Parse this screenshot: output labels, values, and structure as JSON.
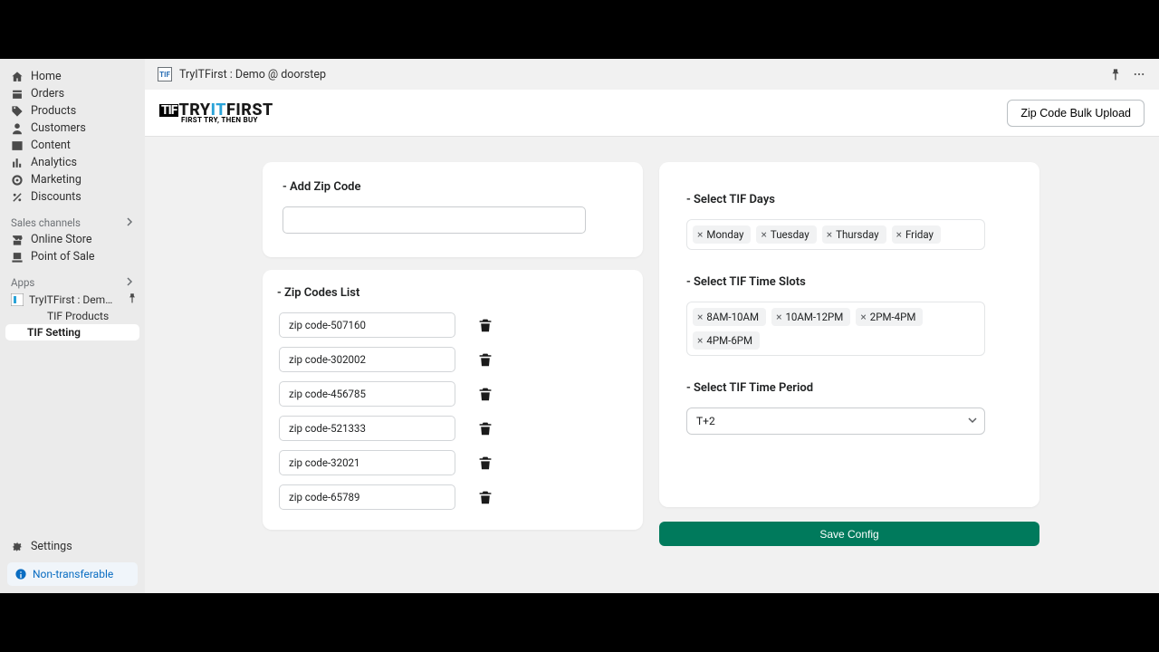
{
  "sidebar": {
    "nav": [
      {
        "label": "Home"
      },
      {
        "label": "Orders"
      },
      {
        "label": "Products"
      },
      {
        "label": "Customers"
      },
      {
        "label": "Content"
      },
      {
        "label": "Analytics"
      },
      {
        "label": "Marketing"
      },
      {
        "label": "Discounts"
      }
    ],
    "channels_label": "Sales channels",
    "channels": [
      {
        "label": "Online Store"
      },
      {
        "label": "Point of Sale"
      }
    ],
    "apps_label": "Apps",
    "app_entry": "TryITFirst : Demo @ d...",
    "app_sub": [
      {
        "label": "TIF Products"
      },
      {
        "label": "TIF Setting",
        "active": true
      }
    ],
    "settings": "Settings",
    "info": "Non-transferable"
  },
  "header": {
    "title": "TryITFirst : Demo @ doorstep"
  },
  "appbar": {
    "brand_primary_try": "TRY",
    "brand_primary_it": "IT",
    "brand_primary_first": "FIRST",
    "brand_tif": "TIF",
    "brand_tag": "FIRST TRY, THEN BUY",
    "bulk_btn": "Zip Code Bulk Upload"
  },
  "add_zip": {
    "title": "- Add Zip Code"
  },
  "zip_list": {
    "title": "- Zip Codes List",
    "items": [
      "zip code-507160",
      "zip code-302002",
      "zip code-456785",
      "zip code-521333",
      "zip code-32021",
      "zip code-65789"
    ]
  },
  "days": {
    "title": "- Select TIF Days",
    "items": [
      "Monday",
      "Tuesday",
      "Thursday",
      "Friday"
    ]
  },
  "slots": {
    "title": "- Select TIF Time Slots",
    "items": [
      "8AM-10AM",
      "10AM-12PM",
      "2PM-4PM",
      "4PM-6PM"
    ]
  },
  "period": {
    "title": "- Select TIF Time Period",
    "value": "T+2"
  },
  "save": "Save Config"
}
